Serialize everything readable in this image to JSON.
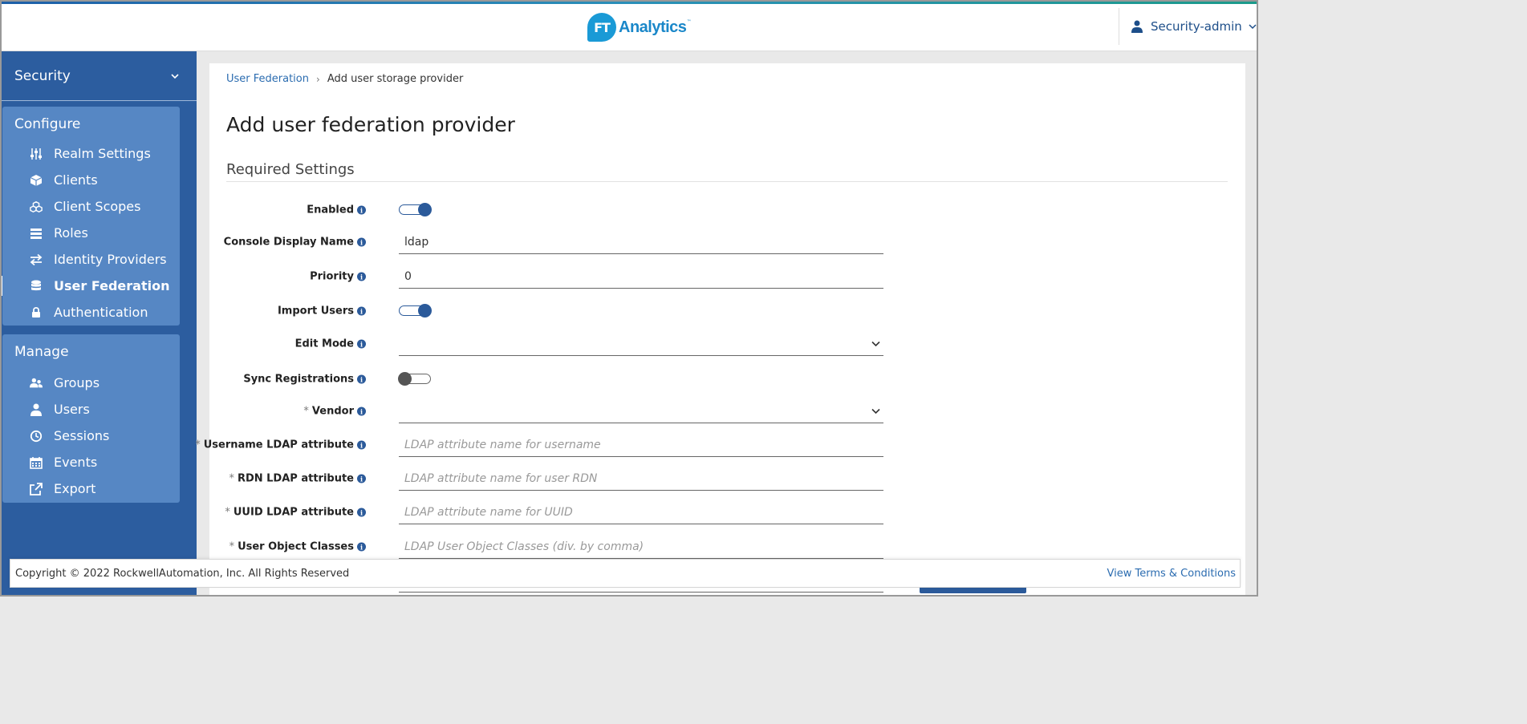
{
  "header": {
    "logo_mark": "FT",
    "logo_text": "Analytics",
    "logo_tm": "™",
    "user_label": "Security-admin"
  },
  "sidebar": {
    "realm": "Security",
    "configure": {
      "title": "Configure",
      "items": [
        {
          "label": "Realm Settings",
          "icon": "sliders-icon"
        },
        {
          "label": "Clients",
          "icon": "cube-icon"
        },
        {
          "label": "Client Scopes",
          "icon": "cubes-icon"
        },
        {
          "label": "Roles",
          "icon": "list-icon"
        },
        {
          "label": "Identity Providers",
          "icon": "exchange-icon"
        },
        {
          "label": "User Federation",
          "icon": "database-icon",
          "active": true
        },
        {
          "label": "Authentication",
          "icon": "lock-icon"
        }
      ]
    },
    "manage": {
      "title": "Manage",
      "items": [
        {
          "label": "Groups",
          "icon": "users-icon"
        },
        {
          "label": "Users",
          "icon": "user-icon"
        },
        {
          "label": "Sessions",
          "icon": "clock-icon"
        },
        {
          "label": "Events",
          "icon": "calendar-icon"
        },
        {
          "label": "Export",
          "icon": "export-icon"
        }
      ]
    }
  },
  "breadcrumb": {
    "link": "User Federation",
    "separator": "›",
    "current": "Add user storage provider"
  },
  "page_title": "Add user federation provider",
  "section_title": "Required Settings",
  "form": {
    "enabled": {
      "label": "Enabled",
      "value": true
    },
    "console_display_name": {
      "label": "Console Display Name",
      "value": "ldap"
    },
    "priority": {
      "label": "Priority",
      "value": "0"
    },
    "import_users": {
      "label": "Import Users",
      "value": true
    },
    "edit_mode": {
      "label": "Edit Mode",
      "value": ""
    },
    "sync_registrations": {
      "label": "Sync Registrations",
      "value": false
    },
    "vendor": {
      "label": "Vendor",
      "required": "*",
      "value": ""
    },
    "username_attr": {
      "label": "Username LDAP attribute",
      "required": "*",
      "placeholder": "LDAP attribute name for username"
    },
    "rdn_attr": {
      "label": "RDN LDAP attribute",
      "required": "*",
      "placeholder": "LDAP attribute name for user RDN"
    },
    "uuid_attr": {
      "label": "UUID LDAP attribute",
      "required": "*",
      "placeholder": "LDAP attribute name for UUID"
    },
    "user_object_classes": {
      "label": "User Object Classes",
      "required": "*",
      "placeholder": "LDAP User Object Classes (div. by comma)"
    }
  },
  "info_glyph": "i",
  "footer": {
    "copyright": "Copyright © 2022 RockwellAutomation, Inc. All Rights Reserved",
    "terms": "View Terms & Conditions"
  },
  "colors": {
    "sidebar_bg": "#2c5d9f",
    "sidebar_group_bg": "#5687c4",
    "accent": "#2b5a9a",
    "link": "#2b6cb0",
    "logo": "#1a9ad6"
  }
}
